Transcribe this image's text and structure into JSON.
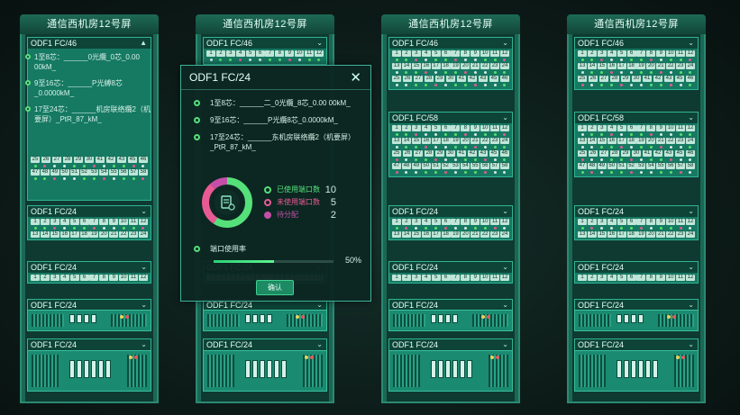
{
  "rack_title": "通信西机房12号屏",
  "panel_labels": {
    "fc46": "ODF1 FC/46",
    "fc58": "ODF1 FC/58",
    "fc24": "ODF1 FC/24"
  },
  "ports_1_12": [
    "1",
    "2",
    "3",
    "4",
    "5",
    "6",
    "7",
    "8",
    "9",
    "10",
    "11",
    "12"
  ],
  "ports_13_24": [
    "13",
    "14",
    "15",
    "16",
    "17",
    "18",
    "19",
    "20",
    "21",
    "22",
    "23",
    "24"
  ],
  "ports_25_46": [
    "25",
    "26",
    "27",
    "28",
    "29",
    "30",
    "41",
    "42",
    "43",
    "45",
    "46"
  ],
  "ports_47_58": [
    "47",
    "48",
    "49",
    "50",
    "51",
    "52",
    "53",
    "54",
    "55",
    "56",
    "57",
    "58"
  ],
  "expanded": {
    "items": [
      "1至8芯：______0光纜_0芯_0.00 00kM_",
      "9至16芯：______P光縛8芯_0.0000kM_",
      "17至24芯：______机房联络纜2（机要屏）_PtR_87_kM_"
    ]
  },
  "modal": {
    "title": "ODF1 FC/24",
    "lines": [
      "1至8芯：______二_0光纜_8芯_0.00 00kM_",
      "9至16芯：______P光纜8芯_0.0000kM_",
      "17至24芯：______东机房联络纜2（机要屏）_PtR_87_kM_"
    ],
    "legend": [
      {
        "label": "已使用端口数",
        "value": "10",
        "color": "#55e07a"
      },
      {
        "label": "未使用端口数",
        "value": "5",
        "color": "#e85a94"
      },
      {
        "label": "待分配",
        "value": "2",
        "color": "#c44ea8"
      }
    ],
    "usage_label": "端口使用率",
    "usage_value": "50%",
    "usage_fraction": 0.5,
    "ok_label": "确认"
  },
  "colors": {
    "accent": "#2fb593",
    "used": "#58e06a",
    "unused": "#e85a94"
  },
  "icons": [
    "close-icon",
    "chevron-down-icon",
    "chevron-up-icon",
    "report-icon"
  ]
}
